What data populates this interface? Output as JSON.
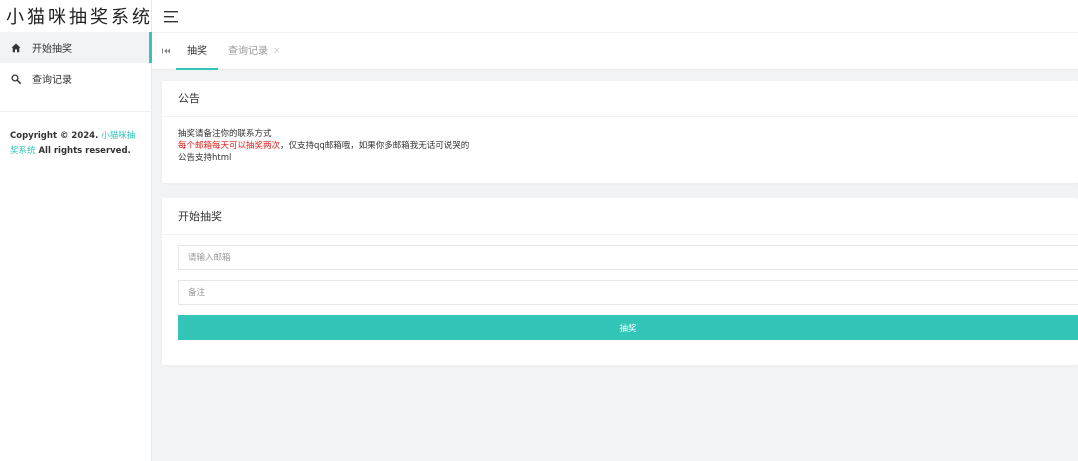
{
  "app": {
    "title": "小猫咪抽奖系统"
  },
  "sidebar": {
    "items": [
      {
        "label": "开始抽奖",
        "icon": "home-icon",
        "active": true
      },
      {
        "label": "查询记录",
        "icon": "search-icon",
        "active": false
      }
    ],
    "copyright": {
      "prefix": "Copyright © 2024. ",
      "site": "小猫咪抽奖系统",
      "suffix": " All rights reserved."
    }
  },
  "tabs": {
    "items": [
      {
        "label": "抽奖",
        "active": true
      },
      {
        "label": "查询记录",
        "active": false
      }
    ],
    "close_glyph": "×"
  },
  "notice": {
    "title": "公告",
    "line1": "抽奖请备注你的联系方式",
    "line2_red": "每个邮箱每天可以抽奖两次",
    "line2_rest": "，仅支持qq邮箱哦，如果你多邮箱我无话可说哭的",
    "line3": "公告支持html"
  },
  "draw": {
    "title": "开始抽奖",
    "email_placeholder": "请输入邮箱",
    "email_value": "",
    "note_placeholder": "备注",
    "note_value": "",
    "button_label": "抽奖"
  },
  "colors": {
    "accent": "#32c5b8",
    "notice_red": "#e02020",
    "background": "#f2f3f5"
  }
}
